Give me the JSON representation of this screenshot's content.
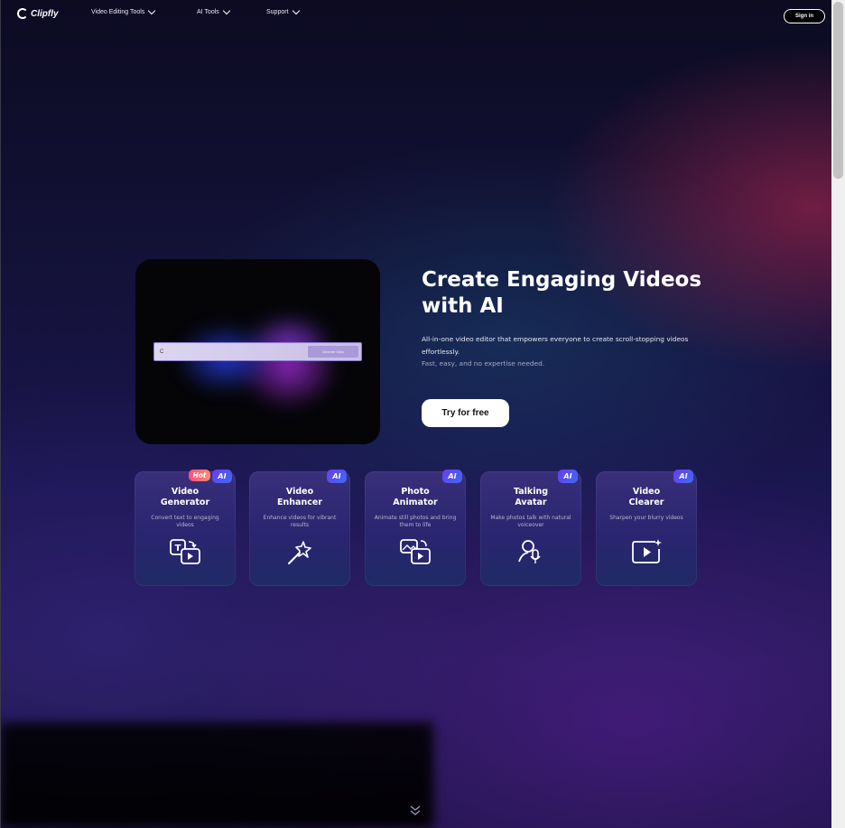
{
  "nav": {
    "logo": "Clipfly",
    "items": [
      {
        "label": "Video Editing Tools"
      },
      {
        "label": "AI Tools"
      },
      {
        "label": "Support"
      }
    ],
    "sign_in": "Sign in"
  },
  "hero": {
    "title_line1": "Create Engaging Videos",
    "title_line2": "with AI",
    "description": "All-in-one video editor that empowers everyone to create scroll-stopping videos effortlessly.",
    "subtext": "Fast, easy, and no expertise needed.",
    "cta": "Try for free",
    "preview": {
      "prompt_text": "C",
      "prompt_button": "Generate Video"
    }
  },
  "cards": [
    {
      "title_line1": "Video",
      "title_line2": "Generator",
      "desc": "Convert text to engaging videos",
      "badge_ai": "AI",
      "badge_hot": "Hot",
      "icon": "text-to-video-icon"
    },
    {
      "title_line1": "Video",
      "title_line2": "Enhancer",
      "desc": "Enhance videos for vibrant results",
      "badge_ai": "AI",
      "icon": "magic-wand-icon"
    },
    {
      "title_line1": "Photo",
      "title_line2": "Animator",
      "desc": "Animate still photos and bring them to life",
      "badge_ai": "AI",
      "icon": "photo-to-video-icon"
    },
    {
      "title_line1": "Talking",
      "title_line2": "Avatar",
      "desc": "Make photos talk with natural voiceover",
      "badge_ai": "AI",
      "icon": "avatar-mic-icon"
    },
    {
      "title_line1": "Video",
      "title_line2": "Clearer",
      "desc": "Sharpen your blurry videos",
      "badge_ai": "AI",
      "icon": "sparkle-video-icon"
    }
  ]
}
